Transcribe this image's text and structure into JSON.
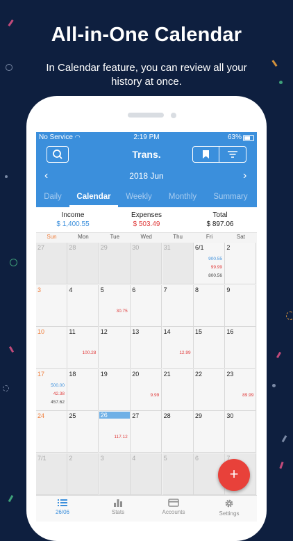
{
  "headline": "All-in-One Calendar",
  "subline": "In Calendar feature, you can review all your history at once.",
  "status": {
    "carrier": "No Service",
    "time": "2:19 PM",
    "battery": "63%"
  },
  "header": {
    "title": "Trans.",
    "search_icon": "search-icon",
    "bookmark_icon": "bookmark-icon",
    "filter_icon": "filter-icon"
  },
  "month": {
    "label": "2018 Jun",
    "prev": "‹",
    "next": "›"
  },
  "tabs": [
    "Daily",
    "Calendar",
    "Weekly",
    "Monthly",
    "Summary"
  ],
  "active_tab": "Calendar",
  "summary": {
    "income_label": "Income",
    "income_value": "$ 1,400.55",
    "expenses_label": "Expenses",
    "expenses_value": "$ 503.49",
    "total_label": "Total",
    "total_value": "$ 897.06"
  },
  "weekdays": [
    "Sun",
    "Mon",
    "Tue",
    "Wed",
    "Thu",
    "Fri",
    "Sat"
  ],
  "weeks": [
    [
      {
        "d": "27",
        "dim": true
      },
      {
        "d": "28",
        "dim": true
      },
      {
        "d": "29",
        "dim": true
      },
      {
        "d": "30",
        "dim": true
      },
      {
        "d": "31",
        "dim": true
      },
      {
        "d": "6/1",
        "inc": "900.55",
        "exp": "99.99",
        "tot": "800.56"
      },
      {
        "d": "2"
      }
    ],
    [
      {
        "d": "3"
      },
      {
        "d": "4"
      },
      {
        "d": "5",
        "exp": "30.75"
      },
      {
        "d": "6"
      },
      {
        "d": "7"
      },
      {
        "d": "8"
      },
      {
        "d": "9"
      }
    ],
    [
      {
        "d": "10"
      },
      {
        "d": "11",
        "exp": "100.28"
      },
      {
        "d": "12"
      },
      {
        "d": "13"
      },
      {
        "d": "14",
        "exp": "12.99"
      },
      {
        "d": "15"
      },
      {
        "d": "16"
      }
    ],
    [
      {
        "d": "17",
        "inc": "500.00",
        "exp": "42.38",
        "tot": "457.62"
      },
      {
        "d": "18"
      },
      {
        "d": "19"
      },
      {
        "d": "20",
        "exp": "9.99"
      },
      {
        "d": "21"
      },
      {
        "d": "22"
      },
      {
        "d": "23",
        "exp": "89.99"
      }
    ],
    [
      {
        "d": "24"
      },
      {
        "d": "25"
      },
      {
        "d": "26",
        "today": true,
        "exp": "117.12"
      },
      {
        "d": "27"
      },
      {
        "d": "28"
      },
      {
        "d": "29"
      },
      {
        "d": "30"
      }
    ],
    [
      {
        "d": "7/1",
        "dim": true
      },
      {
        "d": "2",
        "dim": true
      },
      {
        "d": "3",
        "dim": true
      },
      {
        "d": "4",
        "dim": true
      },
      {
        "d": "5",
        "dim": true
      },
      {
        "d": "6",
        "dim": true
      },
      {
        "d": "7",
        "dim": true
      }
    ]
  ],
  "fab": "+",
  "tabbar": [
    {
      "label": "26/06",
      "icon": "list-icon",
      "active": true
    },
    {
      "label": "Stats",
      "icon": "bar-chart-icon",
      "active": false
    },
    {
      "label": "Accounts",
      "icon": "card-icon",
      "active": false
    },
    {
      "label": "Settings",
      "icon": "gear-icon",
      "active": false
    }
  ],
  "colors": {
    "background": "#0e1f3f",
    "header_blue": "#3b8fdc",
    "income": "#3b8fdc",
    "expense": "#e03a3a",
    "sunday": "#f07f3c",
    "fab": "#e8413a"
  }
}
